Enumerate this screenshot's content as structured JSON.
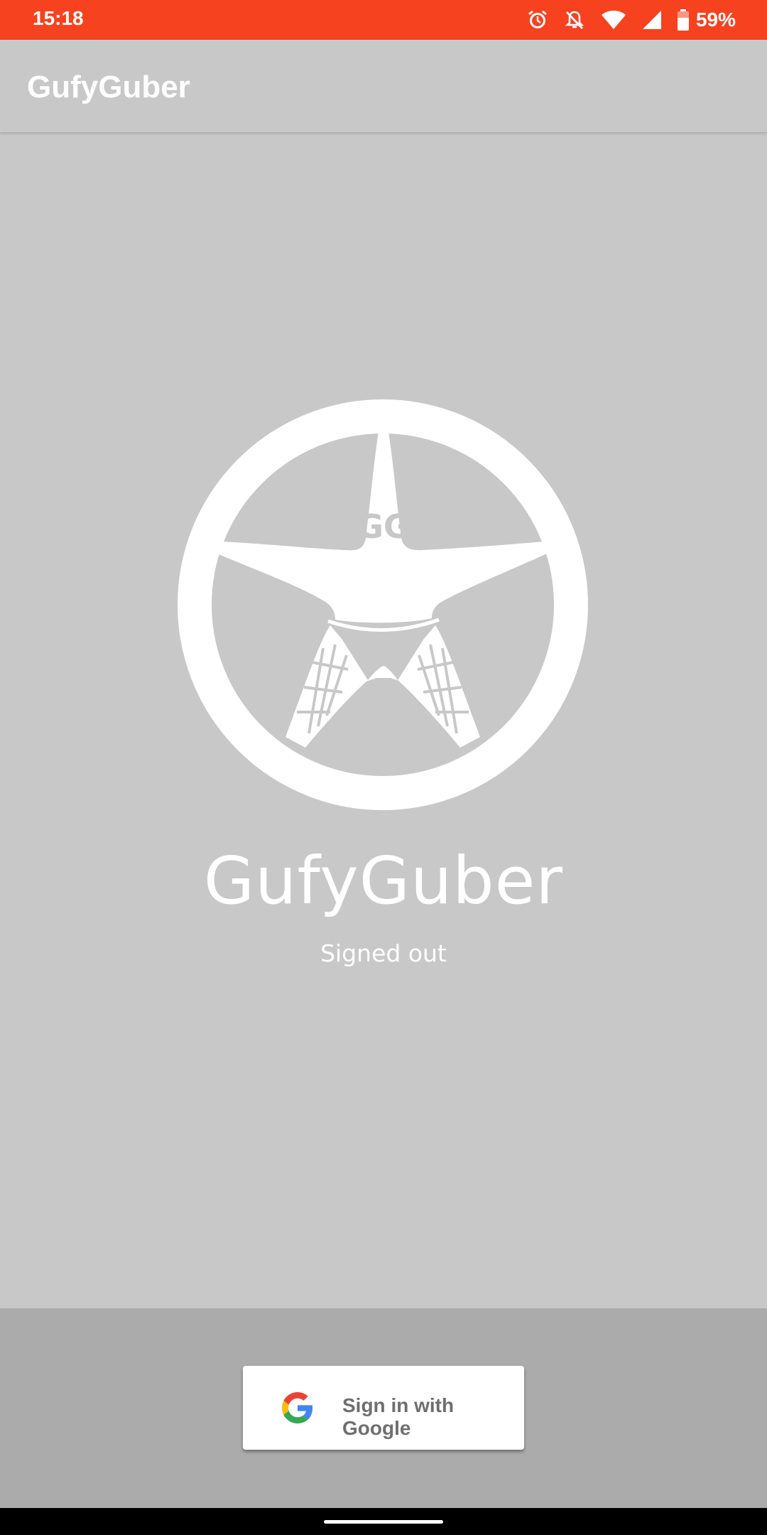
{
  "status_bar": {
    "time": "15:18",
    "battery_percent": "59%",
    "icons": [
      "alarm-icon",
      "notifications-off-icon",
      "wifi-icon",
      "cell-signal-icon",
      "battery-icon"
    ],
    "background_color": "#f6421f"
  },
  "app_bar": {
    "title": "GufyGuber"
  },
  "main": {
    "logo_icon": "gufyguber-logo",
    "app_name": "GufyGuber",
    "status_text": "Signed out"
  },
  "bottom": {
    "sign_in_label": "Sign in with Google",
    "sign_in_icon": "google-g-icon"
  },
  "colors": {
    "status_bar": "#f6421f",
    "background": "#c8c8c8",
    "bottom_panel": "#ababab"
  }
}
